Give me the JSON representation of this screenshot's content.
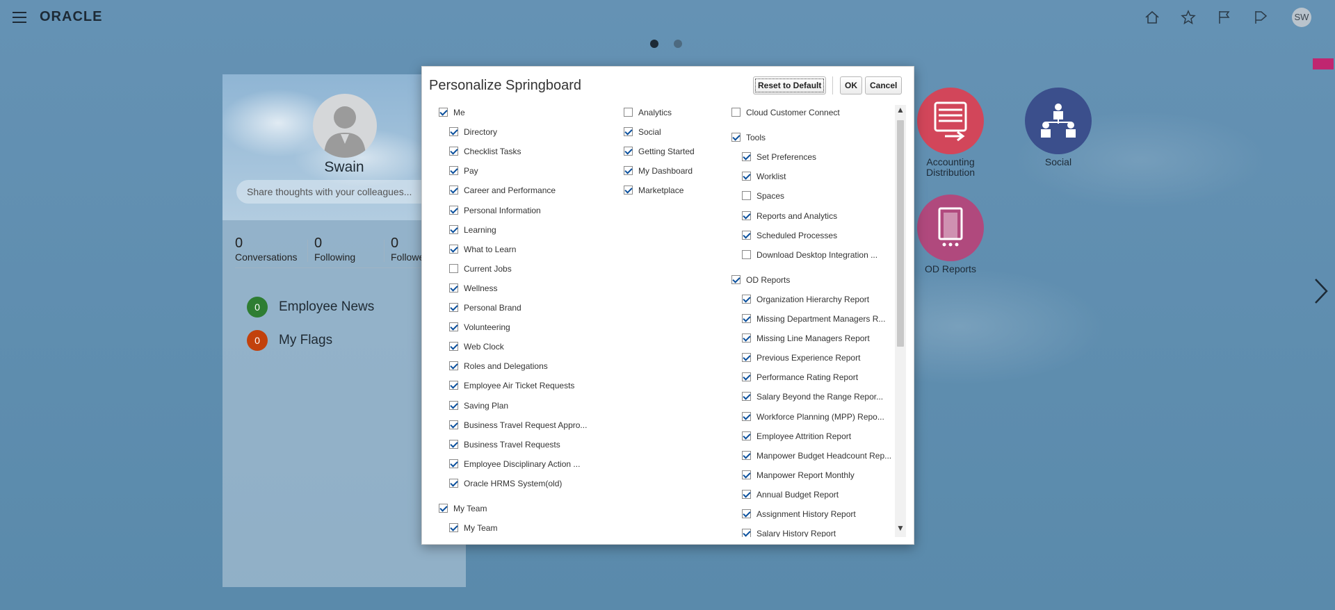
{
  "topbar": {
    "logo": "ORACLE",
    "user_initials": "SW",
    "icons": [
      "home-icon",
      "star-icon",
      "flag-icon",
      "arrow-flag-icon"
    ]
  },
  "profile": {
    "name": "Swain",
    "share_placeholder": "Share thoughts with your colleagues...",
    "stats": [
      {
        "value": "0",
        "label": "Conversations"
      },
      {
        "value": "0",
        "label": "Following"
      },
      {
        "value": "0",
        "label": "Followe"
      }
    ],
    "feeds": [
      {
        "count": "0",
        "label": "Employee News",
        "color": "#2e7d32"
      },
      {
        "count": "0",
        "label": "My Flags",
        "color": "#c2410c"
      }
    ]
  },
  "tiles": [
    {
      "label": "Accounting Distribution",
      "color": "#d2465a"
    },
    {
      "label": "Social",
      "color": "#3b4f8c"
    },
    {
      "label": "OD Reports",
      "color": "#b0497d"
    }
  ],
  "dialog": {
    "title": "Personalize Springboard",
    "reset_label": "Reset to Default",
    "ok_label": "OK",
    "cancel_label": "Cancel",
    "columns": [
      [
        {
          "label": "Me",
          "checked": true,
          "level": 0
        },
        {
          "label": "Directory",
          "checked": true,
          "level": 1
        },
        {
          "label": "Checklist Tasks",
          "checked": true,
          "level": 1
        },
        {
          "label": "Pay",
          "checked": true,
          "level": 1
        },
        {
          "label": "Career and Performance",
          "checked": true,
          "level": 1
        },
        {
          "label": "Personal Information",
          "checked": true,
          "level": 1
        },
        {
          "label": "Learning",
          "checked": true,
          "level": 1
        },
        {
          "label": "What to Learn",
          "checked": true,
          "level": 1
        },
        {
          "label": "Current Jobs",
          "checked": false,
          "level": 1
        },
        {
          "label": "Wellness",
          "checked": true,
          "level": 1
        },
        {
          "label": "Personal Brand",
          "checked": true,
          "level": 1
        },
        {
          "label": "Volunteering",
          "checked": true,
          "level": 1
        },
        {
          "label": "Web Clock",
          "checked": true,
          "level": 1
        },
        {
          "label": "Roles and Delegations",
          "checked": true,
          "level": 1
        },
        {
          "label": "Employee Air Ticket Requests",
          "checked": true,
          "level": 1
        },
        {
          "label": "Saving Plan",
          "checked": true,
          "level": 1
        },
        {
          "label": "Business Travel Request Appro...",
          "checked": true,
          "level": 1
        },
        {
          "label": "Business Travel Requests",
          "checked": true,
          "level": 1
        },
        {
          "label": "Employee Disciplinary Action ...",
          "checked": true,
          "level": 1
        },
        {
          "label": "Oracle HRMS System(old)",
          "checked": true,
          "level": 1
        },
        {
          "label": "My Team",
          "checked": true,
          "level": 0,
          "gap": true
        },
        {
          "label": "My Team",
          "checked": true,
          "level": 1
        }
      ],
      [
        {
          "label": "Analytics",
          "checked": false,
          "level": 0
        },
        {
          "label": "Social",
          "checked": true,
          "level": 0
        },
        {
          "label": "Getting Started",
          "checked": true,
          "level": 0
        },
        {
          "label": "My Dashboard",
          "checked": true,
          "level": 0
        },
        {
          "label": "Marketplace",
          "checked": true,
          "level": 0
        }
      ],
      [
        {
          "label": "Cloud Customer Connect",
          "checked": false,
          "level": 0
        },
        {
          "label": "Tools",
          "checked": true,
          "level": 0,
          "gap": true
        },
        {
          "label": "Set Preferences",
          "checked": true,
          "level": 1
        },
        {
          "label": "Worklist",
          "checked": true,
          "level": 1
        },
        {
          "label": "Spaces",
          "checked": false,
          "level": 1
        },
        {
          "label": "Reports and Analytics",
          "checked": true,
          "level": 1
        },
        {
          "label": "Scheduled Processes",
          "checked": true,
          "level": 1
        },
        {
          "label": "Download Desktop Integration ...",
          "checked": false,
          "level": 1
        },
        {
          "label": "OD Reports",
          "checked": true,
          "level": 0,
          "gap": true
        },
        {
          "label": "Organization Hierarchy Report",
          "checked": true,
          "level": 1
        },
        {
          "label": "Missing Department Managers R...",
          "checked": true,
          "level": 1
        },
        {
          "label": "Missing Line Managers Report",
          "checked": true,
          "level": 1
        },
        {
          "label": "Previous Experience Report",
          "checked": true,
          "level": 1
        },
        {
          "label": "Performance Rating Report",
          "checked": true,
          "level": 1
        },
        {
          "label": "Salary Beyond the Range Repor...",
          "checked": true,
          "level": 1
        },
        {
          "label": "Workforce Planning (MPP) Repo...",
          "checked": true,
          "level": 1
        },
        {
          "label": "Employee Attrition Report",
          "checked": true,
          "level": 1
        },
        {
          "label": "Manpower Budget Headcount Rep...",
          "checked": true,
          "level": 1
        },
        {
          "label": "Manpower Report Monthly",
          "checked": true,
          "level": 1
        },
        {
          "label": "Annual Budget Report",
          "checked": true,
          "level": 1
        },
        {
          "label": "Assignment History Report",
          "checked": true,
          "level": 1
        },
        {
          "label": "Salary History Report",
          "checked": true,
          "level": 1
        }
      ]
    ]
  }
}
